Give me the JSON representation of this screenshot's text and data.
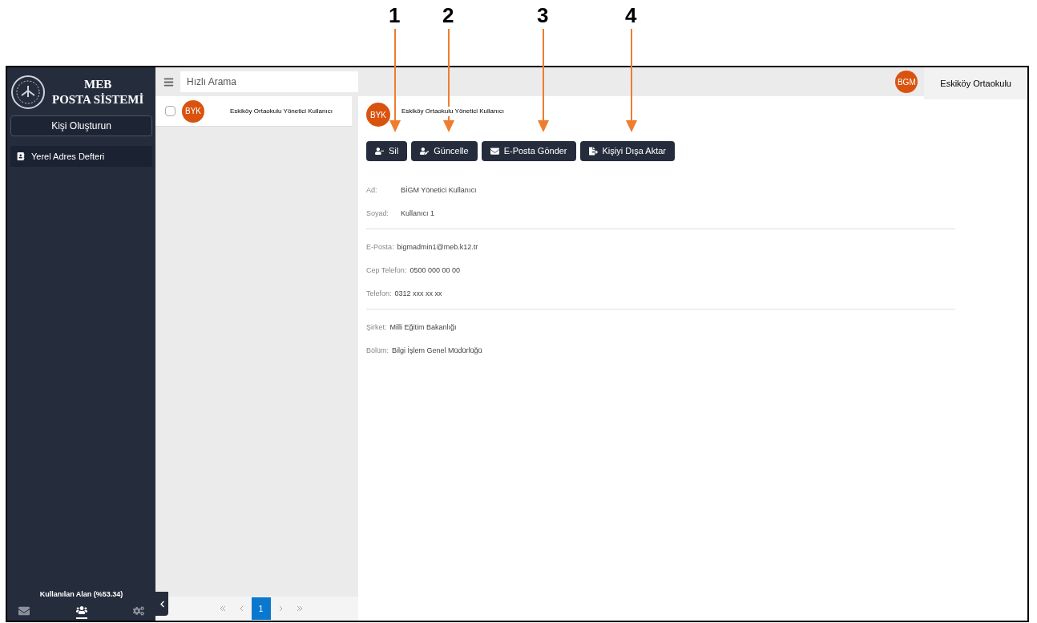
{
  "callouts": [
    {
      "label": "1"
    },
    {
      "label": "2"
    },
    {
      "label": "3"
    },
    {
      "label": "4"
    }
  ],
  "sidebar": {
    "logo_title": "MEB",
    "logo_subtitle": "POSTA SİSTEMİ",
    "create_button": "Kişi Oluşturun",
    "items": [
      {
        "label": "Yerel Adres Defteri",
        "selected": true
      }
    ],
    "usage": "Kullanılan Alan (%53.34)",
    "bottom_tabs": [
      {
        "kind": "mail",
        "selected": false
      },
      {
        "kind": "contacts",
        "selected": true
      },
      {
        "kind": "settings",
        "selected": false
      }
    ]
  },
  "list": {
    "search": {
      "placeholder": "Hızlı Arama"
    },
    "contacts": [
      {
        "initials": "BYK",
        "name": "Eskiköy Ortaokulu Yönetici Kullanıcı",
        "checked": false
      }
    ],
    "pages": [
      {
        "label": "1",
        "selected": true
      }
    ]
  },
  "header": {
    "user_initials": "BGM",
    "school": "Eskiköy Ortaokulu"
  },
  "detail": {
    "initials": "BYK",
    "name": "Eskiköy Ortaokulu Yönetici Kullanıcı",
    "actions": [
      {
        "kind": "delete",
        "label": "Sil"
      },
      {
        "kind": "edit",
        "label": "Güncelle"
      },
      {
        "kind": "mail",
        "label": "E-Posta Gönder"
      },
      {
        "kind": "export",
        "label": "Kişiyi Dışa Aktar"
      }
    ],
    "groups": [
      [
        {
          "label": "Ad:",
          "value": "BİGM Yönetici Kullanıcı"
        },
        {
          "label": "Soyad:",
          "value": "Kullanıcı 1"
        }
      ],
      [
        {
          "label": "E-Posta:",
          "value": "bigmadmin1@meb.k12.tr"
        },
        {
          "label": "Cep Telefon:",
          "value": "0500 000 00 00"
        },
        {
          "label": "Telefon:",
          "value": "0312 xxx xx xx"
        }
      ],
      [
        {
          "label": "Şirket:",
          "value": "Milli Eğitim Bakanlığı"
        },
        {
          "label": "Bölüm:",
          "value": "Bilgi İşlem Genel Müdürlüğü"
        }
      ]
    ]
  }
}
